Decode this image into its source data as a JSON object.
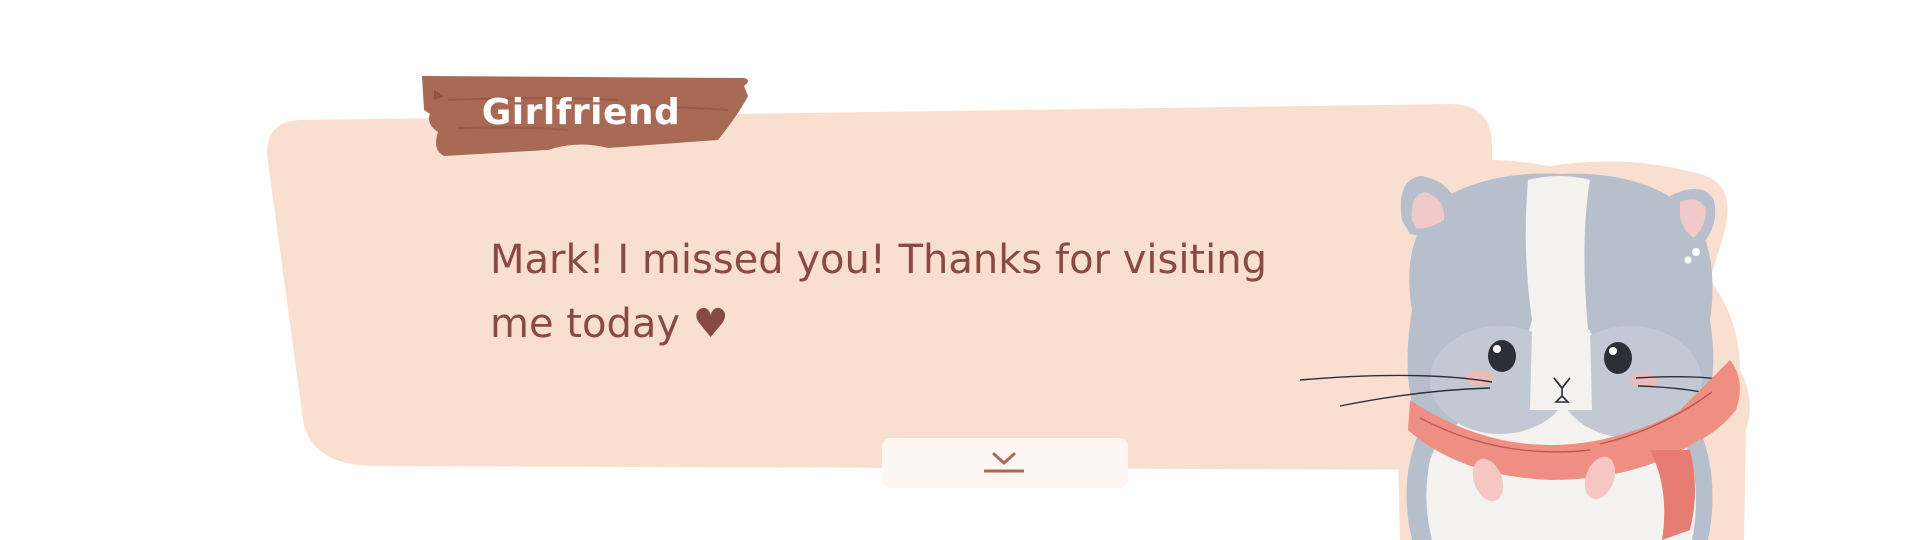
{
  "dialogue": {
    "speaker": "Girlfriend",
    "lines": [
      "Mark! I missed you! Thanks for visiting",
      "me today ♥"
    ]
  },
  "controls": {
    "advance_icon": "chevron-down-underline-icon"
  },
  "character": {
    "name": "hamster-portrait"
  },
  "colors": {
    "bubble": "#f9dfd0",
    "plank": "#a86a55",
    "plank_dark": "#8d5443",
    "text": "#8a4a44",
    "button_bg": "#fdf6f2",
    "scarf": "#ef8f84"
  }
}
